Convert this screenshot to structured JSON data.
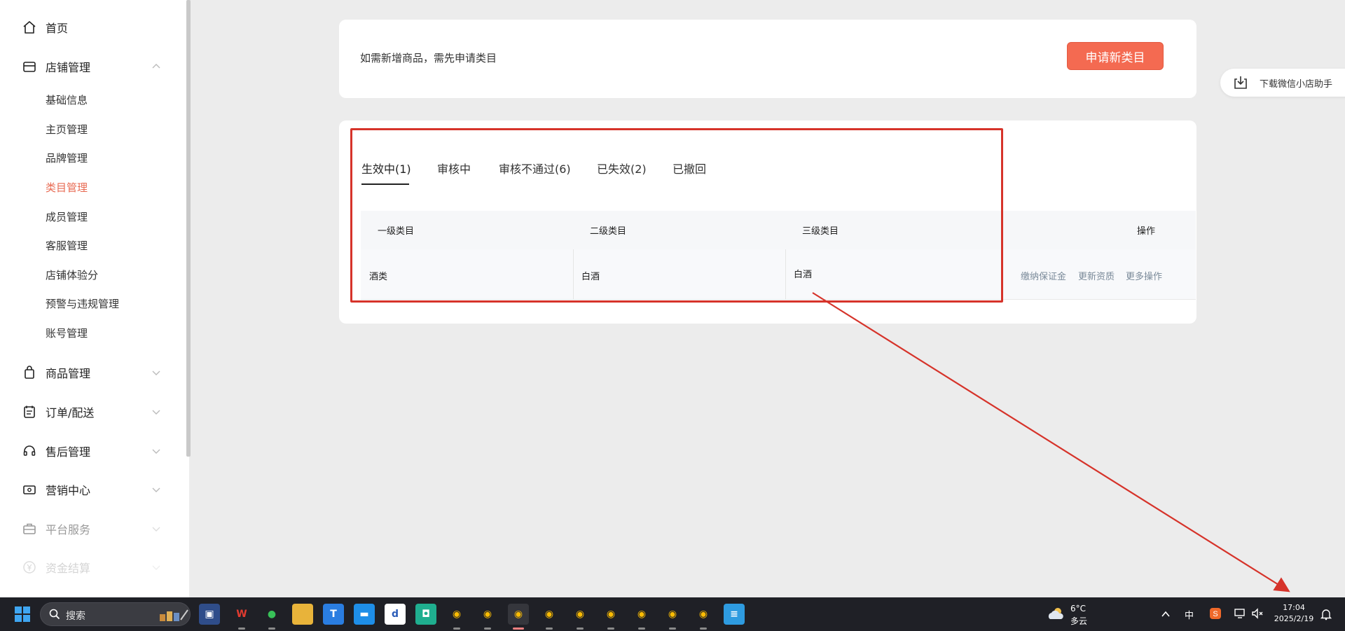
{
  "sidebar": {
    "groups": {
      "home": "首页",
      "store": "店铺管理",
      "goods": "商品管理",
      "orders": "订单/配送",
      "aftersale": "售后管理",
      "marketing": "营销中心",
      "platform": "平台服务",
      "funds": "资金结算"
    },
    "store_items": [
      "基础信息",
      "主页管理",
      "品牌管理",
      "类目管理",
      "成员管理",
      "客服管理",
      "店铺体验分",
      "预警与违规管理",
      "账号管理"
    ],
    "active_item": "类目管理"
  },
  "notice": {
    "text": "如需新增商品，需先申请类目",
    "apply_button": "申请新类目"
  },
  "download_helper": "下载微信小店助手",
  "tabs": [
    "生效中(1)",
    "审核中",
    "审核不通过(6)",
    "已失效(2)",
    "已撤回"
  ],
  "table": {
    "headers": [
      "一级类目",
      "二级类目",
      "三级类目",
      "操作"
    ],
    "rows": [
      {
        "level1": "酒类",
        "level2": "白酒",
        "level3": "白酒",
        "actions": [
          "缴纳保证金",
          "更新资质",
          "更多操作"
        ]
      }
    ]
  },
  "taskbar": {
    "search_label": "搜索",
    "weather_temp": "6°C",
    "weather_desc": "多云",
    "ime": "中",
    "time": "17:04",
    "date": "2025/2/19"
  },
  "colors": {
    "accent": "#f46a51",
    "active_menu": "#e86a52",
    "annotation_red": "#d6332a"
  }
}
